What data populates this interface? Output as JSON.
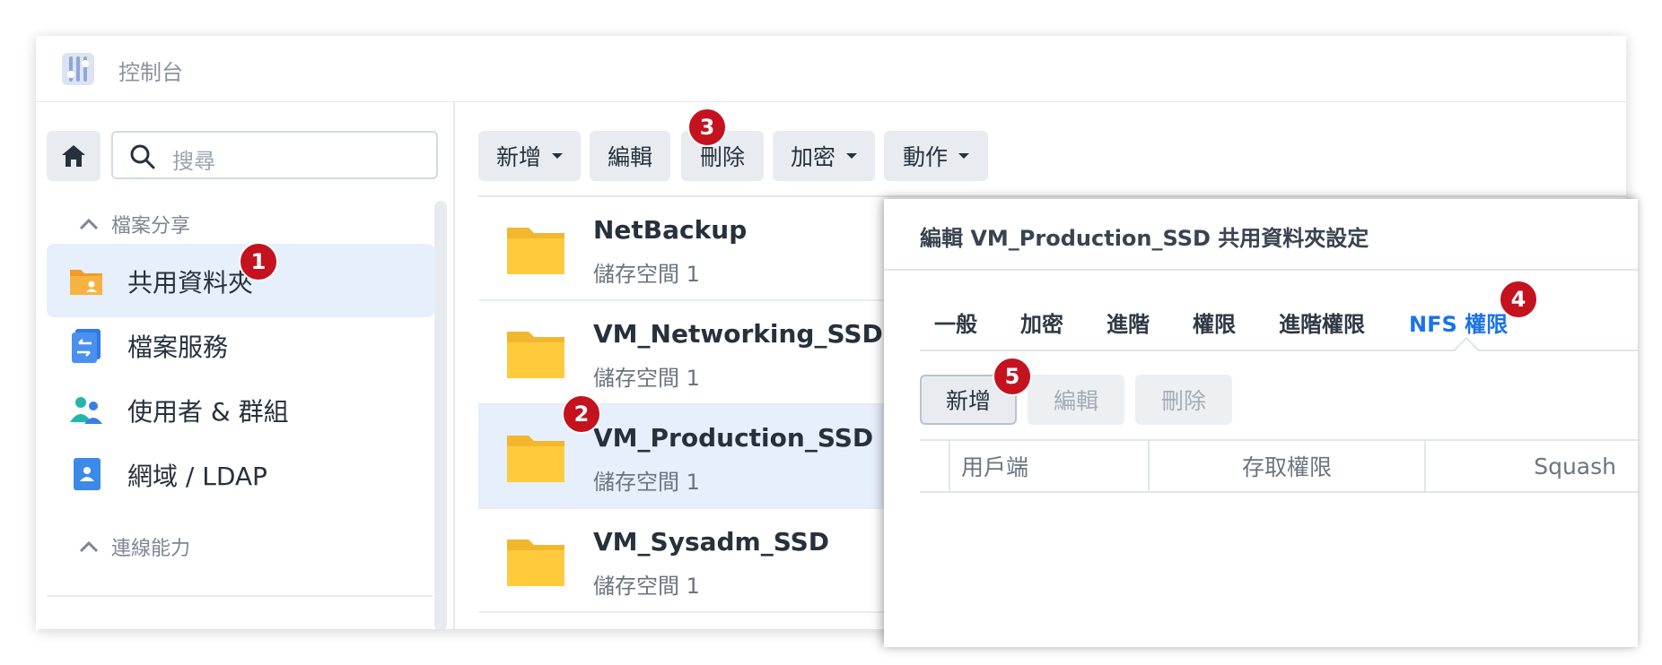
{
  "app": {
    "title": "控制台"
  },
  "sidebar": {
    "search_placeholder": "搜尋",
    "sections": [
      {
        "label": "檔案分享",
        "expanded": true
      },
      {
        "label": "連線能力",
        "expanded": true
      }
    ],
    "items": [
      {
        "label": "共用資料夾",
        "icon": "shared-folder-icon",
        "active": true
      },
      {
        "label": "檔案服務",
        "icon": "file-services-icon",
        "active": false
      },
      {
        "label": "使用者 & 群組",
        "icon": "users-groups-icon",
        "active": false
      },
      {
        "label": "網域 / LDAP",
        "icon": "domain-ldap-icon",
        "active": false
      }
    ]
  },
  "toolbar": {
    "create": "新增",
    "edit": "編輯",
    "delete": "刪除",
    "encrypt": "加密",
    "action": "動作"
  },
  "folders": [
    {
      "name": "NetBackup",
      "volume": "儲存空間 1",
      "selected": false
    },
    {
      "name": "VM_Networking_SSD",
      "volume": "儲存空間 1",
      "selected": false
    },
    {
      "name": "VM_Production_SSD",
      "volume": "儲存空間 1",
      "selected": true
    },
    {
      "name": "VM_Sysadm_SSD",
      "volume": "儲存空間 1",
      "selected": false
    }
  ],
  "dialog": {
    "title": "編輯 VM_Production_SSD 共用資料夾設定",
    "tabs": [
      "一般",
      "加密",
      "進階",
      "權限",
      "進階權限",
      "NFS 權限"
    ],
    "active_tab": "NFS 權限",
    "buttons": {
      "create": "新增",
      "edit": "編輯",
      "delete": "刪除"
    },
    "columns": [
      "用戶端",
      "存取權限",
      "Squash"
    ]
  },
  "annotations": [
    "1",
    "2",
    "3",
    "4",
    "5"
  ],
  "colors": {
    "accent": "#1a73e8",
    "badge": "#c4121f",
    "selected": "#e6effc",
    "folder": "#ffcb3d"
  }
}
